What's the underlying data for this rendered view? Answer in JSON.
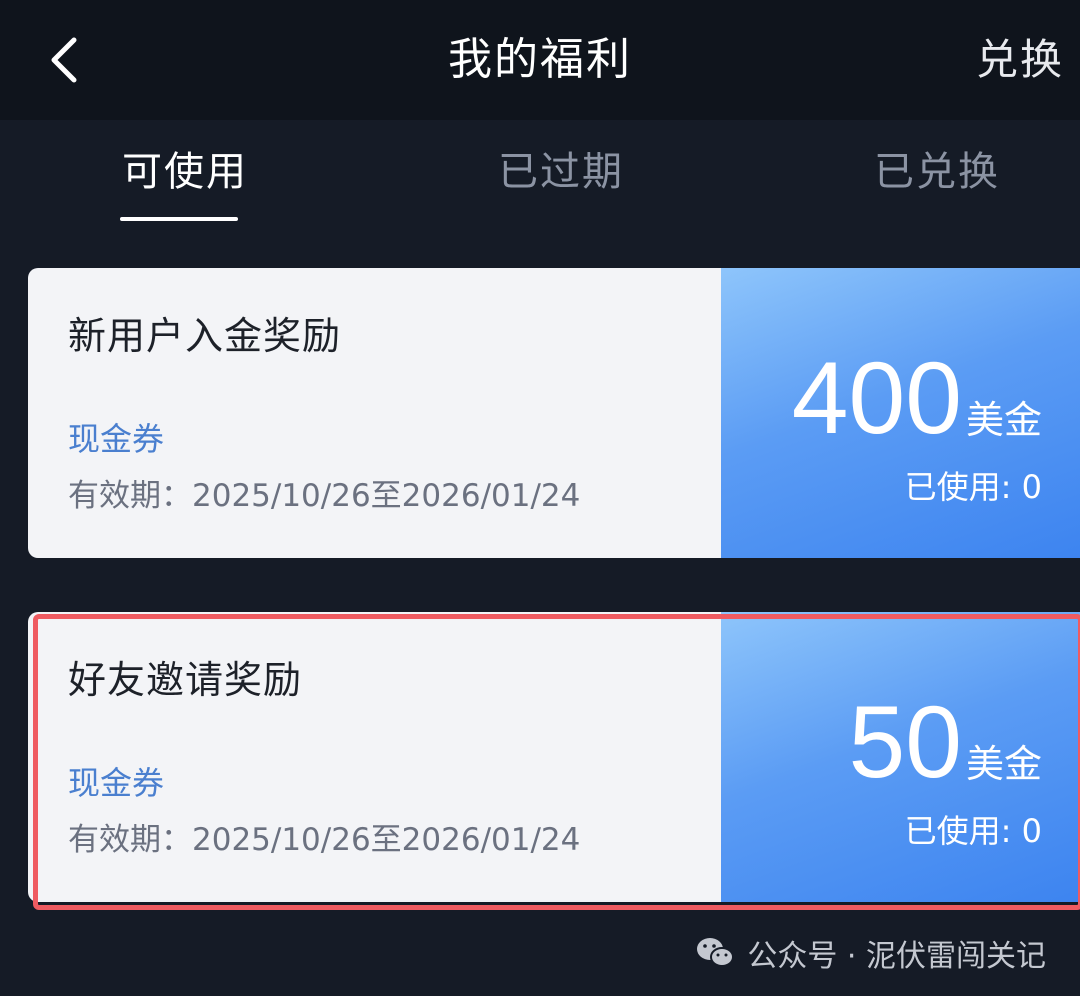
{
  "header": {
    "title": "我的福利",
    "exchange_label": "兑换"
  },
  "tabs": [
    {
      "label": "可使用",
      "active": true
    },
    {
      "label": "已过期",
      "active": false
    },
    {
      "label": "已兑换",
      "active": false
    }
  ],
  "cards": [
    {
      "name": "新用户入金奖励",
      "type": "现金券",
      "validity": "有效期：2025/10/26至2026/01/24",
      "amount": "400",
      "unit": "美金",
      "used": "已使用: 0"
    },
    {
      "name": "好友邀请奖励",
      "type": "现金券",
      "validity": "有效期：2025/10/26至2026/01/24",
      "amount": "50",
      "unit": "美金",
      "used": "已使用: 0",
      "highlighted": true
    }
  ],
  "footer": {
    "watermark": "公众号 · 泥伏雷闯关记"
  },
  "colors": {
    "background": "#151b26",
    "header": "#0f141c",
    "card_bg": "#f3f4f7",
    "accent_blue": "#4a7fcf",
    "highlight_red": "#ef5b61"
  }
}
